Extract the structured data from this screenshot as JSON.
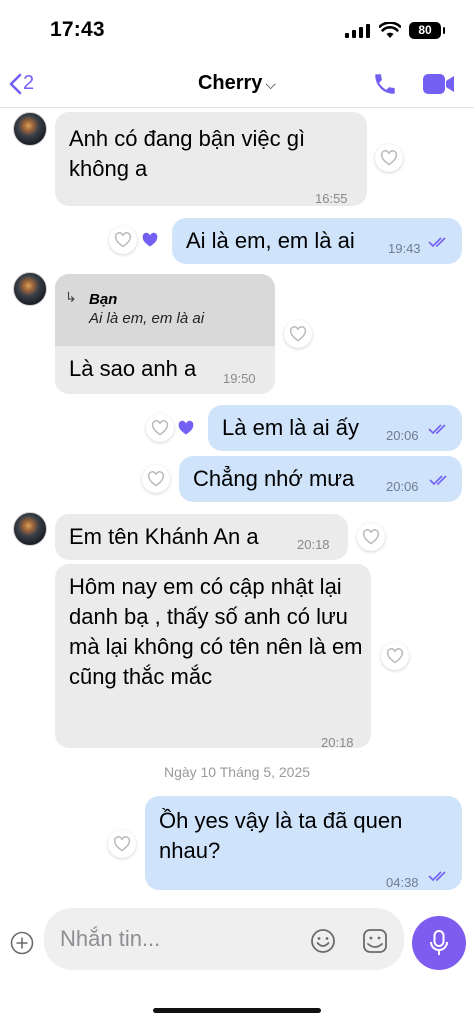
{
  "status_bar": {
    "time": "17:43",
    "battery": "80"
  },
  "header": {
    "back_count": "2",
    "contact_name": "Cherry",
    "chevron": "⌵"
  },
  "colors": {
    "accent": "#7360f2",
    "incoming_bubble": "#ebebeb",
    "outgoing_bubble": "#cfe3fb",
    "mic_button": "#7e5cf0"
  },
  "messages": [
    {
      "direction": "incoming",
      "text": "Anh có đang bận việc gì không a",
      "time": "16:55",
      "liked": false
    },
    {
      "direction": "outgoing",
      "text": "Ai là em, em là ai",
      "time": "19:43",
      "liked": true
    },
    {
      "direction": "incoming",
      "reply_to": {
        "name": "Bạn",
        "text": "Ai là em, em là ai"
      },
      "text": "Là sao anh a",
      "time": "19:50",
      "liked": false
    },
    {
      "direction": "outgoing",
      "text": "Là em là ai ấy",
      "time": "20:06",
      "liked": true
    },
    {
      "direction": "outgoing",
      "text": "Chẳng nhớ mưa",
      "time": "20:06",
      "liked": false
    },
    {
      "direction": "incoming",
      "text": "Em tên Khánh An a",
      "time": "20:18",
      "liked": false
    },
    {
      "direction": "incoming",
      "text": "Hôm nay em có cập nhật lại danh bạ  , thấy số anh có lưu mà lại không có tên nên là em cũng thắc mắc",
      "time": "20:18",
      "liked": false
    },
    {
      "direction": "outgoing",
      "text": "Ồh yes vậy là ta đã quen nhau?",
      "time": "04:38",
      "liked": false
    }
  ],
  "date_separator": "Ngày 10 Tháng 5, 2025",
  "composer": {
    "placeholder": "Nhắn tin..."
  },
  "icons": [
    "back-chevron-icon",
    "phone-icon",
    "video-camera-icon",
    "heart-icon",
    "double-check-icon",
    "reply-arrow-icon",
    "plus-icon",
    "emoji-icon",
    "sticker-icon",
    "microphone-icon"
  ]
}
